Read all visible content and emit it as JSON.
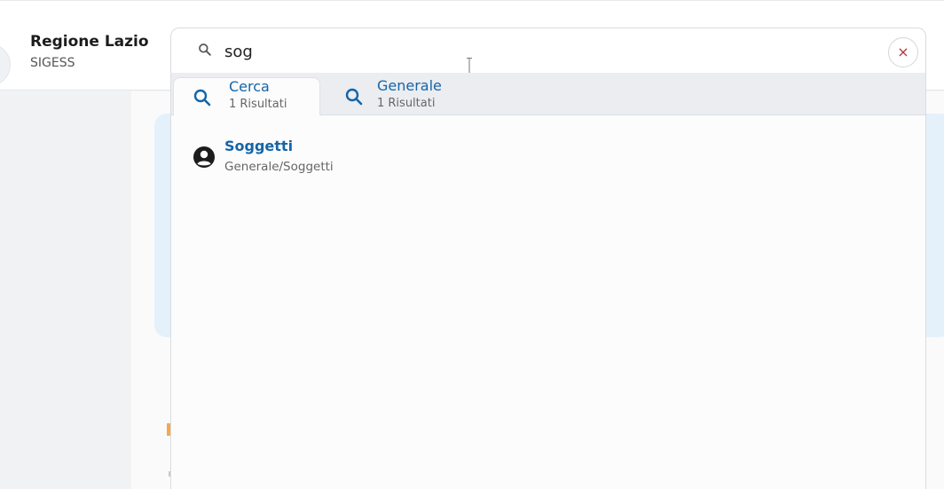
{
  "header": {
    "title": "Regione Lazio",
    "subtitle": "SIGESS"
  },
  "search": {
    "value": "sog",
    "clear_glyph": "×"
  },
  "tabs": [
    {
      "label": "Cerca",
      "count": "1 Risultati",
      "icon": "search-icon",
      "active": true
    },
    {
      "label": "Generale",
      "count": "1 Risultati",
      "icon": "search-icon",
      "active": false
    }
  ],
  "results": [
    {
      "title": "Soggetti",
      "path": "Generale/Soggetti",
      "icon": "user-circle-icon"
    }
  ],
  "colors": {
    "accent": "#1565a8",
    "clear": "#b0373b",
    "card": "#e4f1fb"
  }
}
